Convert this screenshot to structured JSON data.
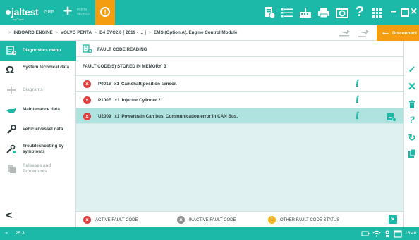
{
  "app": {
    "logo": "jaltest",
    "logo_sub": "by Cojali",
    "group": "GRP",
    "parts_search": "PARTS SEARCH"
  },
  "breadcrumb": [
    "INBOARD ENGINE",
    "VOLVO PENTA",
    "D4 EVC2.0 [ 2019 - ... ]",
    "EMS (Option A), Engine Control Module"
  ],
  "disconnect_label": "Disconnect",
  "sidebar": {
    "items": [
      {
        "label": "Diagnostics menu",
        "state": "active",
        "icon": "diagnostics-icon"
      },
      {
        "label": "System technical data",
        "state": "normal",
        "icon": "ohm-icon"
      },
      {
        "label": "Diagrams",
        "state": "disabled",
        "icon": "diagram-icon"
      },
      {
        "label": "Maintenance data",
        "state": "normal",
        "icon": "oil-can-icon"
      },
      {
        "label": "Vehicle/vessel data",
        "state": "normal",
        "icon": "wrench-icon"
      },
      {
        "label": "Troubleshooting by symptoms",
        "state": "normal",
        "icon": "troubleshoot-icon"
      },
      {
        "label": "Releases and Procedures",
        "state": "disabled",
        "icon": "releases-icon"
      }
    ]
  },
  "main": {
    "title": "FAULT CODE READING",
    "stored_text": "FAULT CODE(S) STORED IN MEMORY: 3",
    "faults": [
      {
        "code": "P0016",
        "count": "x1",
        "description": "Camshaft position sensor.",
        "selected": false
      },
      {
        "code": "P100E",
        "count": "x1",
        "description": "Injector Cylinder 2.",
        "selected": false
      },
      {
        "code": "U2009",
        "count": "x1",
        "description": "Powertrain Can bus. Communication error in CAN Bus.",
        "selected": true
      }
    ],
    "legend": {
      "active": "ACTIVE FAULT CODE",
      "inactive": "INACTIVE FAULT CODE",
      "other": "OTHER FAULT CODE STATUS"
    }
  },
  "status": {
    "voltage": "25.3",
    "time": "15:46"
  },
  "colors": {
    "accent": "#1cb9a8",
    "warning": "#f59d10",
    "error": "#e43b3b",
    "selected_row": "#aee3df"
  }
}
